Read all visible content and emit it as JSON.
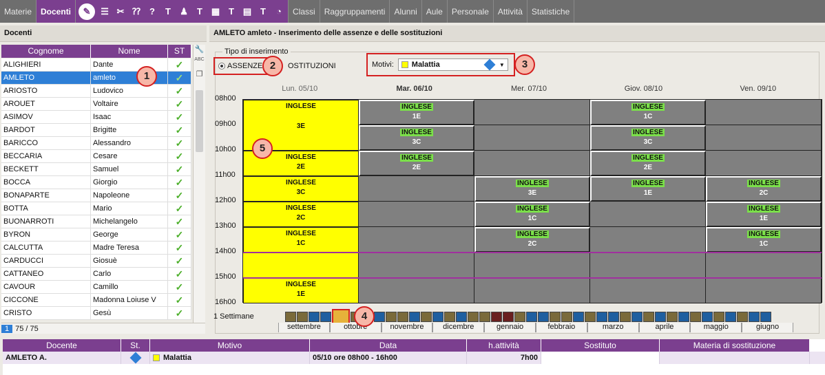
{
  "topbar": {
    "tabs_left": [
      "Materie",
      "Docenti"
    ],
    "icons": [
      "edit-icon",
      "list-icon",
      "tools-icon",
      "question-grid-icon",
      "question-icon",
      "T-icon",
      "group-icon",
      "T-clock-icon",
      "grid-icon",
      "T-x-icon",
      "table-icon",
      "T-arrow-icon",
      "T-clock2-icon"
    ],
    "tabs_right": [
      "Classi",
      "Raggruppamenti",
      "Alunni",
      "Aule",
      "Personale",
      "Attività",
      "Statistiche"
    ]
  },
  "left_panel": {
    "title": "Docenti",
    "columns": [
      "Cognome",
      "Nome",
      "ST"
    ],
    "rows": [
      {
        "cognome": "ALIGHIERI",
        "nome": "Dante"
      },
      {
        "cognome": "AMLETO",
        "nome": "amleto"
      },
      {
        "cognome": "ARIOSTO",
        "nome": "Ludovico"
      },
      {
        "cognome": "AROUET",
        "nome": "Voltaire"
      },
      {
        "cognome": "ASIMOV",
        "nome": "Isaac"
      },
      {
        "cognome": "BARDOT",
        "nome": "Brigitte"
      },
      {
        "cognome": "BARICCO",
        "nome": "Alessandro"
      },
      {
        "cognome": "BECCARIA",
        "nome": "Cesare"
      },
      {
        "cognome": "BECKETT",
        "nome": "Samuel"
      },
      {
        "cognome": "BOCCA",
        "nome": "Giorgio"
      },
      {
        "cognome": "BONAPARTE",
        "nome": "Napoleone"
      },
      {
        "cognome": "BOTTA",
        "nome": "Mario"
      },
      {
        "cognome": "BUONARROTI",
        "nome": "Michelangelo"
      },
      {
        "cognome": "BYRON",
        "nome": "George"
      },
      {
        "cognome": "CALCUTTA",
        "nome": "Madre Teresa"
      },
      {
        "cognome": "CARDUCCI",
        "nome": "Giosuè"
      },
      {
        "cognome": "CATTANEO",
        "nome": "Carlo"
      },
      {
        "cognome": "CAVOUR",
        "nome": "Camillo"
      },
      {
        "cognome": "CICCONE",
        "nome": "Madonna Loiuse V"
      },
      {
        "cognome": "CRISTO",
        "nome": "Gesù"
      }
    ],
    "check": "✓",
    "pager_page": "1",
    "pager_count": "75 / 75"
  },
  "right_panel": {
    "title": "AMLETO amleto - Inserimento delle assenze e delle sostituzioni",
    "tipo_label": "Tipo di inserimento",
    "radio_assenze": "ASSENZE",
    "radio_sost": "OSTITUZIONI",
    "motivi_label": "Motivi:",
    "motivi_value": "Malattia",
    "days": [
      "Lun. 05/10",
      "Mar. 06/10",
      "Mer. 07/10",
      "Giov. 08/10",
      "Ven. 09/10"
    ],
    "hours": [
      "08h00",
      "09h00",
      "10h00",
      "11h00",
      "12h00",
      "13h00",
      "14h00",
      "15h00",
      "16h00"
    ],
    "subject": "INGLESE",
    "settimane_label": "1  Settimane",
    "months": [
      "settembre",
      "ottobre",
      "novembre",
      "dicembre",
      "gennaio",
      "febbraio",
      "marzo",
      "aprile",
      "maggio",
      "giugno"
    ]
  },
  "callouts": [
    "1",
    "2",
    "3",
    "4",
    "5"
  ],
  "bottom_table": {
    "columns": [
      "Docente",
      "St.",
      "Motivo",
      "Data",
      "h.attività",
      "Sostituto",
      "Materia di sostituzione"
    ],
    "row": {
      "docente": "AMLETO A.",
      "motivo": "Malattia",
      "data": "05/10 ore 08h00 - 16h00",
      "h_attivita": "7h00",
      "sostituto": "",
      "materia": ""
    }
  },
  "colors": {
    "accent": "#7b3f8f",
    "selected": "#2e7fd6",
    "absence": "#ffff00",
    "course": "#808080",
    "subject_tag": "#7be04a"
  }
}
